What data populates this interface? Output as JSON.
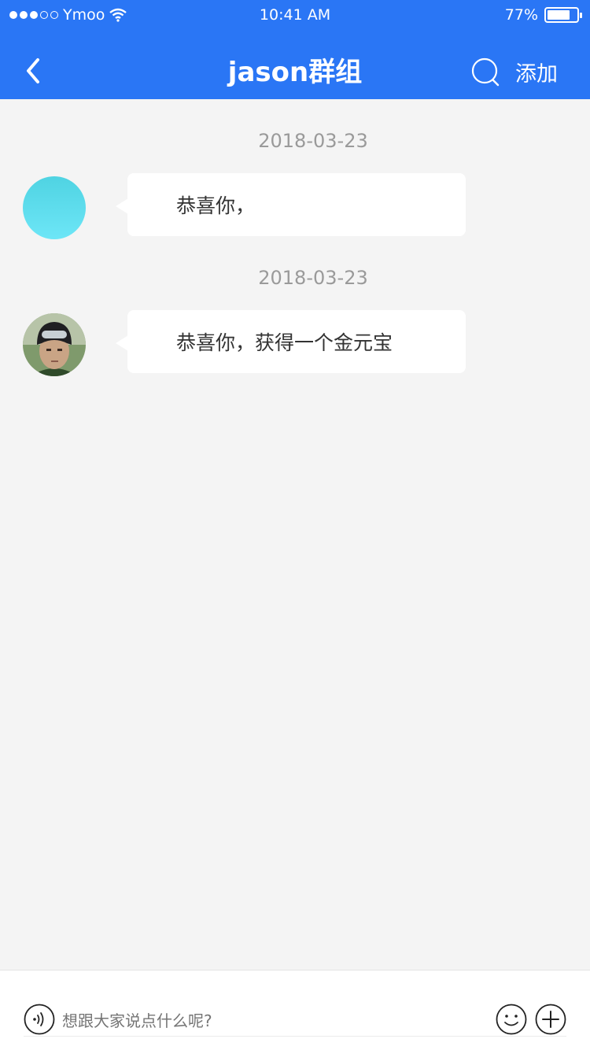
{
  "status_bar": {
    "carrier": "Ymoo",
    "time": "10:41 AM",
    "battery_percent": "77%",
    "battery_level": 0.77,
    "signal_bars_filled": 3,
    "signal_bars_total": 5
  },
  "nav": {
    "title": "jason群组",
    "back_icon": "chevron-left-icon",
    "search_icon": "search-icon",
    "add_label": "添加"
  },
  "messages": [
    {
      "date": "2018-03-23",
      "avatar": "teal-avatar",
      "text": "恭喜你，"
    },
    {
      "date": "2018-03-23",
      "avatar": "photo-avatar",
      "text": "恭喜你，获得一个金元宝"
    }
  ],
  "input": {
    "placeholder": "想跟大家说点什么呢?",
    "voice_icon": "voice-icon",
    "emoji_icon": "emoji-icon",
    "plus_icon": "plus-icon"
  },
  "colors": {
    "header": "#2a76f5",
    "background": "#f4f4f4",
    "bubble": "#ffffff"
  }
}
